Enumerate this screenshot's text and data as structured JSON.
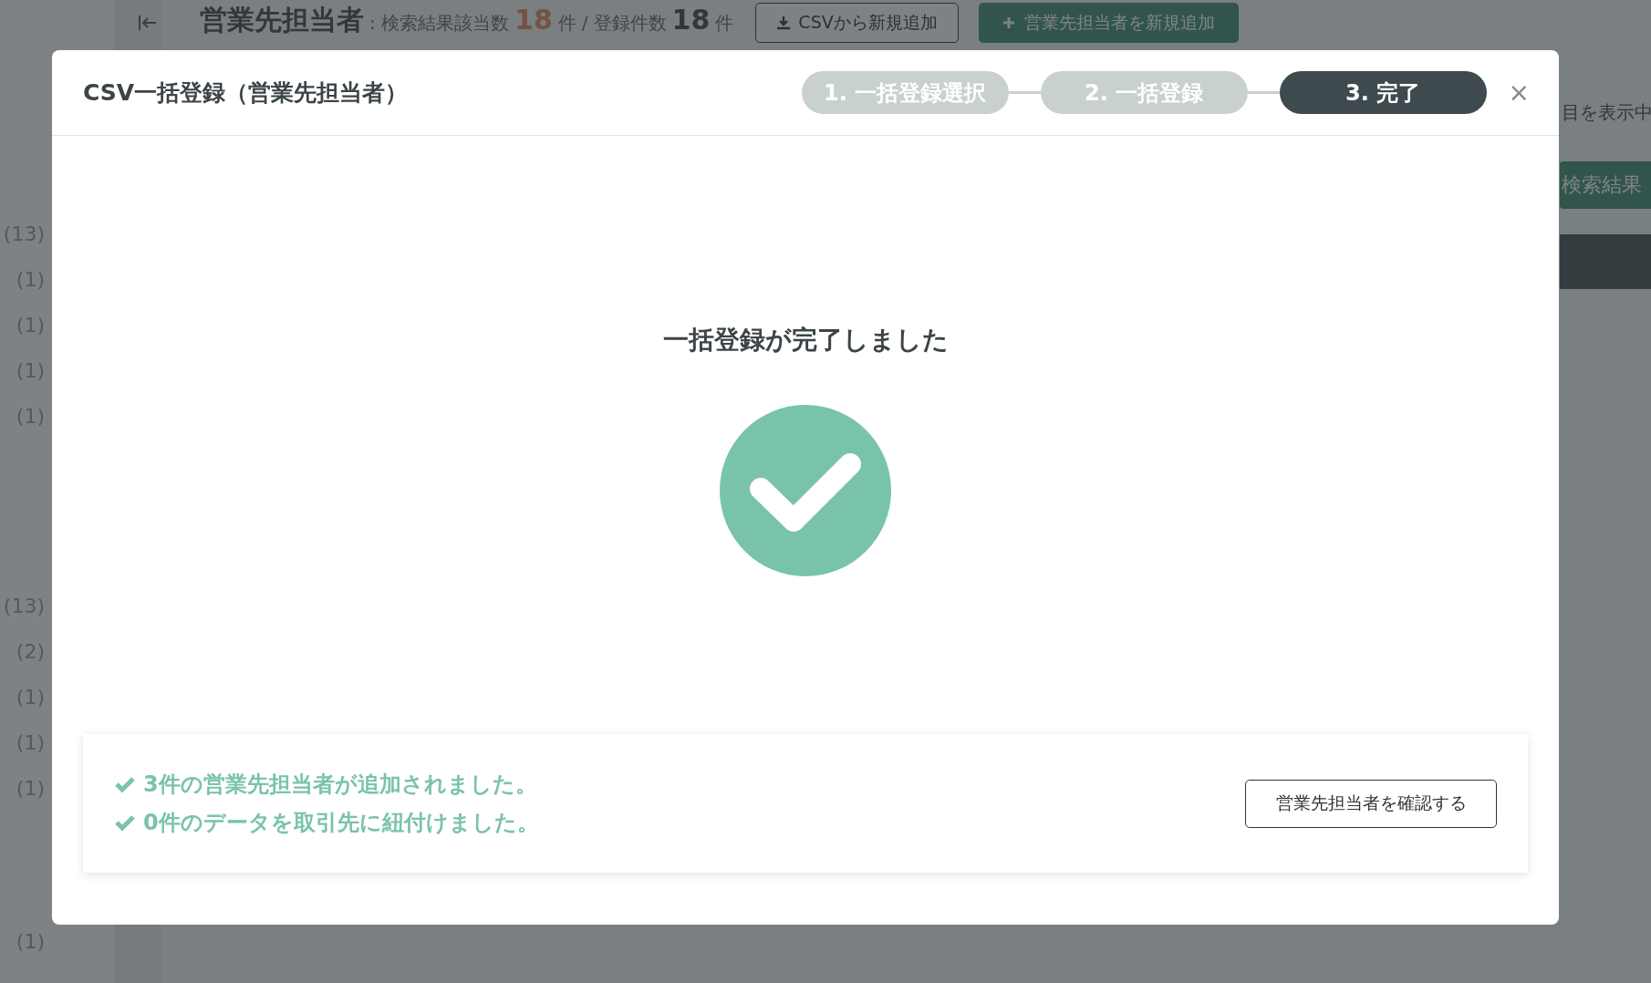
{
  "page": {
    "header": {
      "title": "営業先担当者",
      "result_label": ": 検索結果該当数",
      "result_count": "18",
      "result_unit": "件",
      "separator": "/",
      "total_label": "登録件数",
      "total_count": "18",
      "total_unit": "件",
      "csv_button": "CSVから新規追加",
      "add_button": "営業先担当者を新規追加"
    },
    "filter_groups": [
      [
        "(13)",
        "(1)",
        "(1)",
        "(1)",
        "(1)"
      ],
      [
        "(13)",
        "(2)",
        "(1)",
        "(1)",
        "(1)"
      ],
      [
        "(1)"
      ]
    ],
    "display_note": "目を表示中",
    "search_all_button": "検索結果"
  },
  "modal": {
    "title": "CSV一括登録（営業先担当者）",
    "steps": [
      {
        "label": "1. 一括登録選択",
        "selected": false
      },
      {
        "label": "2. 一括登録",
        "selected": false
      },
      {
        "label": "3. 完了",
        "selected": true
      }
    ],
    "close": "×",
    "heading": "一括登録が完了しました",
    "messages": [
      "3件の営業先担当者が追加されました。",
      "0件のデータを取引先に紐付けました。"
    ],
    "confirm_button": "営業先担当者を確認する"
  }
}
